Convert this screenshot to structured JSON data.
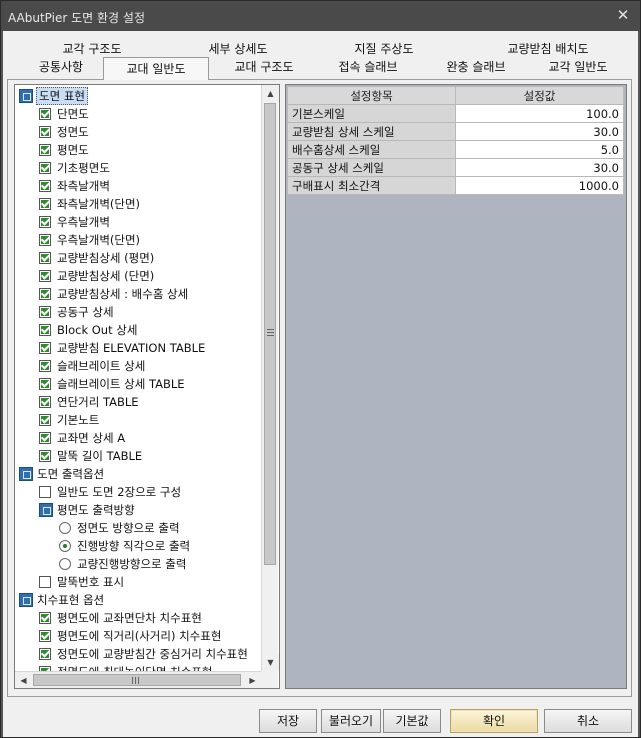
{
  "window": {
    "title": "AAbutPier 도면 환경 설정",
    "close_glyph": "✕"
  },
  "tabs": {
    "row1": [
      "교각 구조도",
      "세부 상세도",
      "지질 주상도",
      "교량받침 배치도"
    ],
    "row2": [
      "공통사항",
      "교대 일반도",
      "교대 구조도",
      "접속 슬래브",
      "완충 슬래브",
      "교각 일반도"
    ],
    "selected": "교대 일반도"
  },
  "tree": {
    "groups": [
      {
        "label": "도면 표현",
        "items": [
          {
            "label": "단면도",
            "checked": true
          },
          {
            "label": "정면도",
            "checked": true
          },
          {
            "label": "평면도",
            "checked": true
          },
          {
            "label": "기초평면도",
            "checked": true
          },
          {
            "label": "좌측날개벽",
            "checked": true
          },
          {
            "label": "좌측날개벽(단면)",
            "checked": true
          },
          {
            "label": "우측날개벽",
            "checked": true
          },
          {
            "label": "우측날개벽(단면)",
            "checked": true
          },
          {
            "label": "교량받침상세 (평면)",
            "checked": true
          },
          {
            "label": "교량받침상세 (단면)",
            "checked": true
          },
          {
            "label": "교량받침상세 : 배수홈 상세",
            "checked": true
          },
          {
            "label": "공동구 상세",
            "checked": true
          },
          {
            "label": "Block Out 상세",
            "checked": true
          },
          {
            "label": "교량받침 ELEVATION TABLE",
            "checked": true
          },
          {
            "label": "슬래브레이트 상세",
            "checked": true
          },
          {
            "label": "슬래브레이트 상세 TABLE",
            "checked": true
          },
          {
            "label": "연단거리 TABLE",
            "checked": true
          },
          {
            "label": "기본노트",
            "checked": true
          },
          {
            "label": "교좌면 상세 A",
            "checked": true
          },
          {
            "label": "말뚝 길이 TABLE",
            "checked": true
          }
        ]
      },
      {
        "label": "도면 출력옵션",
        "items": [
          {
            "label": "일반도 도면 2장으로 구성",
            "checked": false
          }
        ],
        "subgroup": {
          "label": "평면도 출력방향",
          "options": [
            {
              "label": "정면도 방향으로 출력",
              "selected": false
            },
            {
              "label": "진행방향 직각으로 출력",
              "selected": true
            },
            {
              "label": "교량진행방향으로 출력",
              "selected": false
            }
          ]
        },
        "after": [
          {
            "label": "말뚝번호 표시",
            "checked": false
          }
        ]
      },
      {
        "label": "치수표현 옵션",
        "items": [
          {
            "label": "평면도에 교좌면단차 치수표현",
            "checked": true
          },
          {
            "label": "평면도에 직거리(사거리) 치수표현",
            "checked": true
          },
          {
            "label": "정면도에 교량받침간 중심거리 치수표현",
            "checked": true
          },
          {
            "label": "정면도에 최대높이단면 치수표현",
            "checked": true
          }
        ]
      }
    ]
  },
  "grid": {
    "headers": [
      "설정항목",
      "설정값"
    ],
    "rows": [
      {
        "name": "기본스케일",
        "value": "100.0"
      },
      {
        "name": "교량받침 상세 스케일",
        "value": "30.0"
      },
      {
        "name": "배수홈상세 스케일",
        "value": "5.0"
      },
      {
        "name": "공동구 상세 스케일",
        "value": "30.0"
      },
      {
        "name": "구배표시 최소간격",
        "value": "1000.0"
      }
    ]
  },
  "buttons": {
    "save": "저장",
    "load": "불러오기",
    "default": "기본값",
    "ok": "확인",
    "cancel": "취소"
  }
}
